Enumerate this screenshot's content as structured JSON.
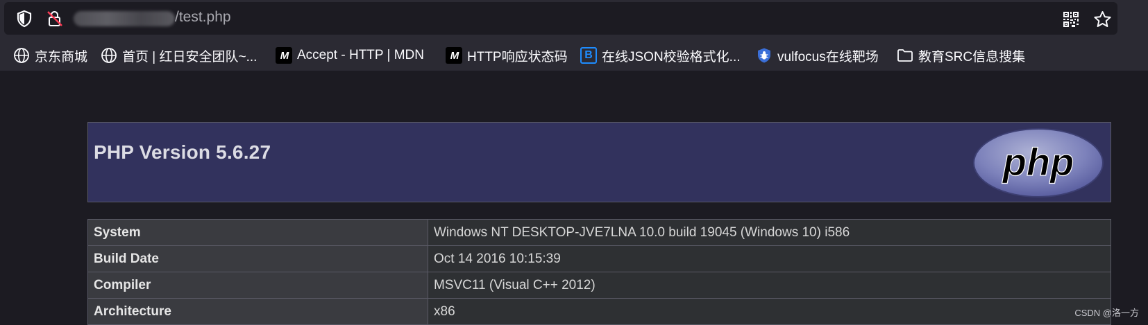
{
  "address_bar": {
    "url_visible": "/test.php",
    "qr_icon": "qr-code-icon",
    "bookmark_star_icon": "star-icon"
  },
  "bookmarks": [
    {
      "label": "京东商城",
      "icon": "globe-icon"
    },
    {
      "label": "首页 | 红日安全团队~...",
      "icon": "globe-icon"
    },
    {
      "label": "Accept - HTTP | MDN",
      "icon": "mdn-icon"
    },
    {
      "label": "HTTP响应状态码",
      "icon": "mdn-icon"
    },
    {
      "label": "在线JSON校验格式化...",
      "icon": "bejson-icon"
    },
    {
      "label": "vulfocus在线靶场",
      "icon": "bug-shield-icon"
    },
    {
      "label": "教育SRC信息搜集",
      "icon": "folder-icon"
    }
  ],
  "phpinfo": {
    "title": "PHP Version 5.6.27",
    "logo_text": "php",
    "rows": [
      {
        "key": "System",
        "value": "Windows NT DESKTOP-JVE7LNA 10.0 build 19045 (Windows 10) i586"
      },
      {
        "key": "Build Date",
        "value": "Oct 14 2016 10:15:39"
      },
      {
        "key": "Compiler",
        "value": "MSVC11 (Visual C++ 2012)"
      },
      {
        "key": "Architecture",
        "value": "x86"
      }
    ]
  },
  "watermark": "CSDN @洛一方",
  "colors": {
    "header_bg": "#32325d",
    "chrome_bg": "#2b2a33",
    "page_bg": "#1c1b22"
  }
}
